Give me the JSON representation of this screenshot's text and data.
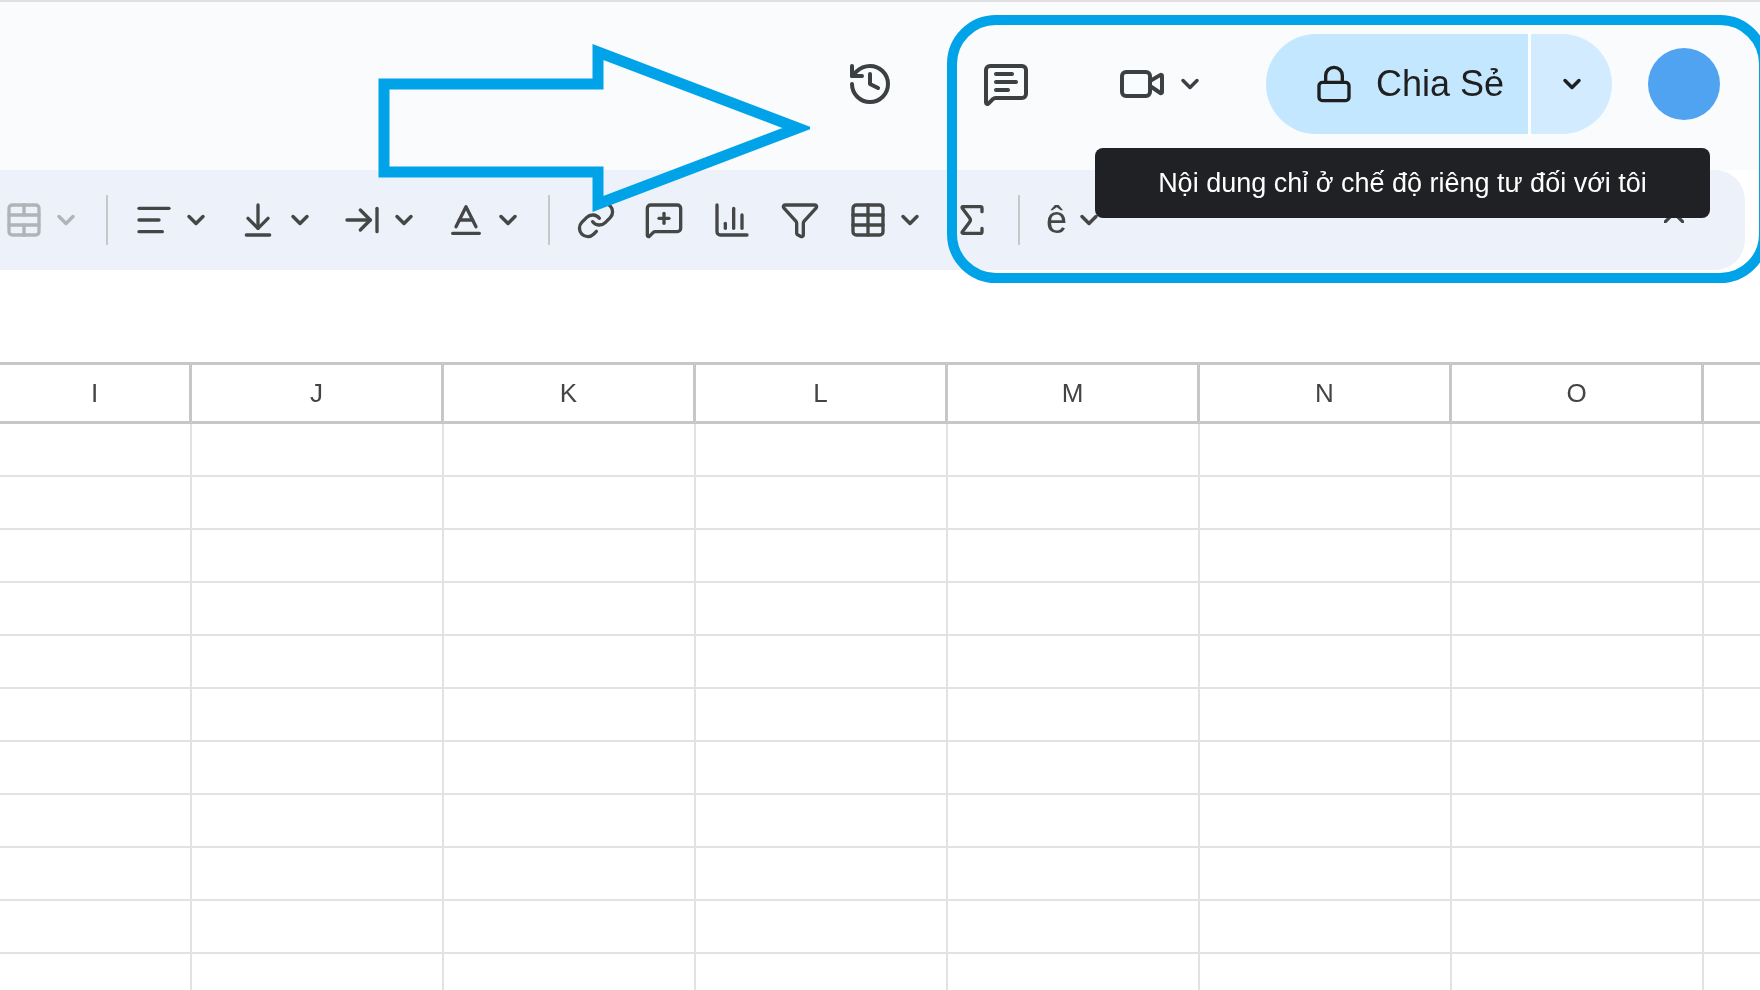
{
  "header": {
    "actions": [
      {
        "kind": "history",
        "dropdown": false
      },
      {
        "kind": "comments",
        "dropdown": false
      },
      {
        "kind": "meet",
        "dropdown": true
      }
    ],
    "share": {
      "label": "Chia Sẻ",
      "locked": true
    },
    "avatar": {
      "kind": "account"
    }
  },
  "toolbar": {
    "items": [
      {
        "kind": "merge",
        "dropdown": true,
        "disabled": true
      },
      {
        "kind": "divider"
      },
      {
        "kind": "align",
        "dropdown": true,
        "disabled": false
      },
      {
        "kind": "valign",
        "dropdown": true,
        "disabled": false
      },
      {
        "kind": "wrap",
        "dropdown": true,
        "disabled": false
      },
      {
        "kind": "text-color",
        "dropdown": true,
        "disabled": false
      },
      {
        "kind": "divider"
      },
      {
        "kind": "link",
        "dropdown": false,
        "disabled": false
      },
      {
        "kind": "comment",
        "dropdown": false,
        "disabled": false
      },
      {
        "kind": "chart",
        "dropdown": false,
        "disabled": false
      },
      {
        "kind": "filter",
        "dropdown": false,
        "disabled": false
      },
      {
        "kind": "table",
        "dropdown": true,
        "disabled": false
      },
      {
        "kind": "sigma",
        "dropdown": false,
        "disabled": false
      },
      {
        "kind": "divider"
      },
      {
        "kind": "input-tools",
        "label": "ê",
        "dropdown": true,
        "disabled": false
      }
    ],
    "tooltip": "Nội dung chỉ ở chế độ riêng tư đối với tôi"
  },
  "sheet": {
    "columns": [
      "I",
      "J",
      "K",
      "L",
      "M",
      "N",
      "O"
    ]
  },
  "annotations": [
    {
      "kind": "arrow"
    },
    {
      "kind": "highlight-box"
    }
  ]
}
